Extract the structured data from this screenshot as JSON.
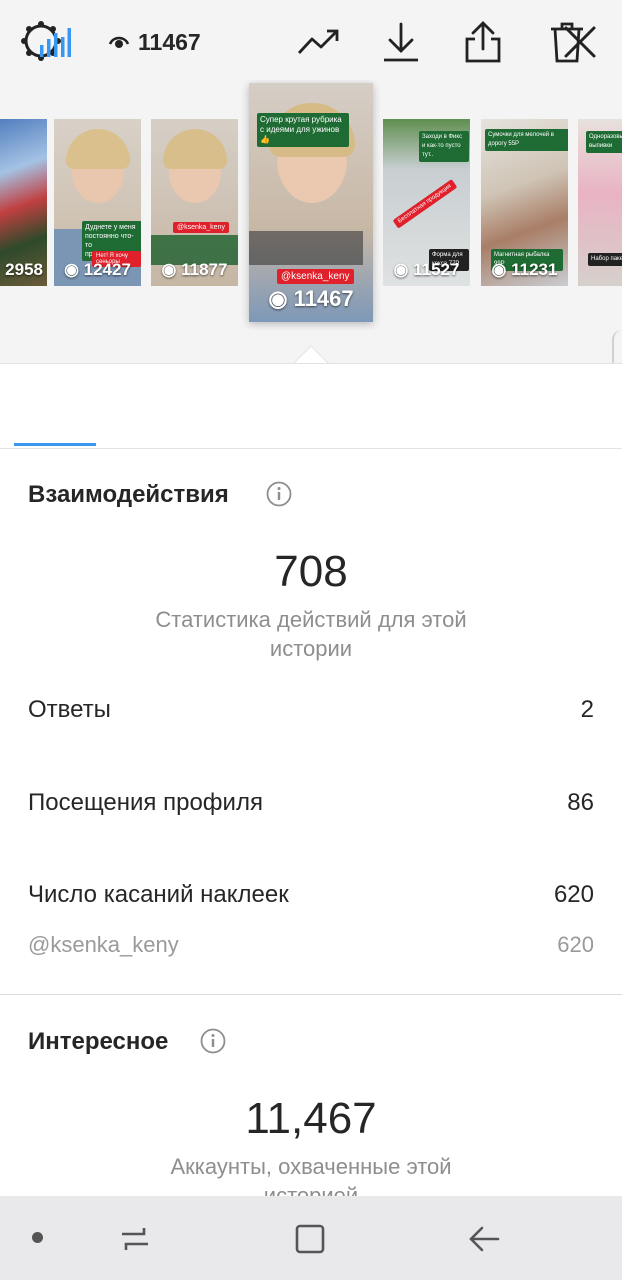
{
  "colors": {
    "accent": "#3897f0",
    "text": "#262626",
    "muted": "#8e8e8e",
    "story_green": "#1e6b33",
    "story_red": "#e0202a"
  },
  "header": {
    "settings_icon": "gear-icon",
    "close_icon": "close-icon"
  },
  "stories": [
    {
      "views": "2958"
    },
    {
      "views": "12427",
      "tag": "Дуднете у меня постоянно что-то происходит??",
      "red": "Нет! Я хочу сеньоры"
    },
    {
      "views": "11877",
      "handle": "@ksenka_keny"
    },
    {
      "views": "11467",
      "tag": "Супер крутая рубрика с идеями для ужинов 👍",
      "handle": "@ksenka_keny",
      "active": true
    },
    {
      "views": "11527",
      "tag": "Заходи в Фикс и как-то пусто тут..",
      "red": "Бесплатная продукция",
      "bottom": "Форма для кекса 77Р"
    },
    {
      "views": "11231",
      "tag": "Сумочки для мелочей в дорогу 55Р",
      "bottom": "Магнитная рыбалка 99Р"
    },
    {
      "views": "",
      "tag": "Одноразовые для выпивки",
      "bottom": "Набор пакетов"
    }
  ],
  "toolbar": {
    "stats_icon": "bar-chart-icon",
    "eye_icon": "eye-icon",
    "views": "11467",
    "trend_icon": "trend-icon",
    "download_icon": "download-icon",
    "share_icon": "share-icon",
    "delete_icon": "trash-icon"
  },
  "interactions": {
    "title": "Взаимодействия",
    "total": "708",
    "subtitle": "Статистика действий для этой истории",
    "rows": [
      {
        "label": "Ответы",
        "value": "2"
      },
      {
        "label": "Посещения профиля",
        "value": "86"
      },
      {
        "label": "Число касаний наклеек",
        "value": "620"
      }
    ],
    "sticker_sub": {
      "label": "@ksenka_keny",
      "value": "620"
    }
  },
  "discovery": {
    "title": "Интересное",
    "total": "11,467",
    "subtitle": "Аккаунты, охваченные этой историей"
  },
  "navbar": {
    "dot": "dot-icon",
    "recent": "recent-apps-icon",
    "home": "home-icon",
    "back": "back-icon"
  }
}
